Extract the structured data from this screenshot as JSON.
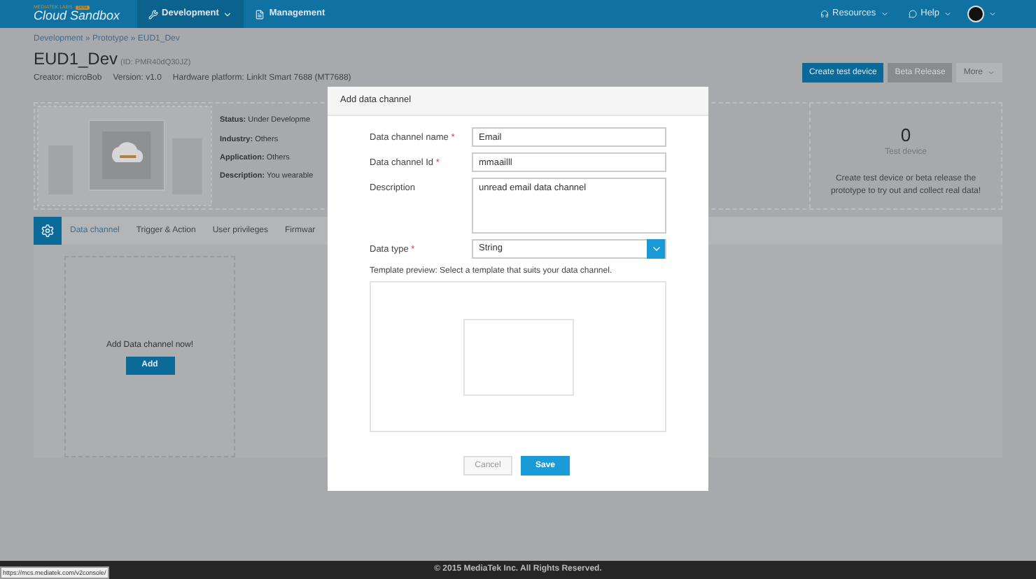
{
  "header": {
    "logo_small": "MEDIATEK LABS",
    "logo_badge": "beta",
    "logo": "Cloud Sandbox",
    "nav": [
      {
        "label": "Development",
        "selected": true
      },
      {
        "label": "Management",
        "selected": false
      }
    ],
    "right_menu": [
      {
        "label": "Resources"
      },
      {
        "label": "Help"
      }
    ]
  },
  "breadcrumb": "Development » Prototype » EUD1_Dev",
  "title": "EUD1_Dev",
  "title_id": "(ID: PMR40dQ30JZ)",
  "meta": [
    {
      "key": "Creator:",
      "value": "microBob"
    },
    {
      "key": "Version:",
      "value": "v1.0"
    },
    {
      "key": "Hardware platform:",
      "value": "LinkIt Smart 7688 (MT7688)"
    }
  ],
  "actions": [
    {
      "label": "Create test device",
      "disabled": false,
      "dropdown": false
    },
    {
      "label": "Beta Release",
      "disabled": true,
      "dropdown": false
    },
    {
      "label": "More",
      "disabled": false,
      "dropdown": true
    }
  ],
  "info": [
    {
      "key": "Status:",
      "value": "Under Developme"
    },
    {
      "key": "Industry:",
      "value": "Others"
    },
    {
      "key": "Application:",
      "value": "Others"
    },
    {
      "key": "Description:",
      "value": "You wearable"
    }
  ],
  "test_devices": {
    "count": "0",
    "label": "Test device",
    "hint": "Create test device or beta release the prototype to try out and collect real data!"
  },
  "tabs": [
    {
      "label": "Data channel",
      "selected": true
    },
    {
      "label": "Trigger & Action",
      "selected": false
    },
    {
      "label": "User privileges",
      "selected": false
    },
    {
      "label": "Firmwar",
      "selected": false
    }
  ],
  "empty_state": {
    "text": "Add Data channel now!",
    "button": "Add"
  },
  "dialog": {
    "title": "Add data channel",
    "fields": [
      {
        "label": "Data channel name",
        "mark": "*",
        "value": "Email",
        "kind": "text"
      },
      {
        "label": "Data channel Id",
        "mark": "*",
        "value": "mmaailll",
        "kind": "text"
      },
      {
        "label": "Description",
        "value": "unread email data channel",
        "kind": "textarea"
      },
      {
        "label": "Data type",
        "mark": "*",
        "value": "String",
        "kind": "select"
      }
    ],
    "preview_label": "Template preview: Select a template that suits your data channel.",
    "buttons": [
      {
        "label": "Cancel",
        "kind": "secondary"
      },
      {
        "label": "Save",
        "kind": "primary"
      }
    ]
  },
  "footer": "© 2015 MediaTek Inc. All Rights Reserved.",
  "status_url": "https://mcs.mediatek.com/v2console/"
}
